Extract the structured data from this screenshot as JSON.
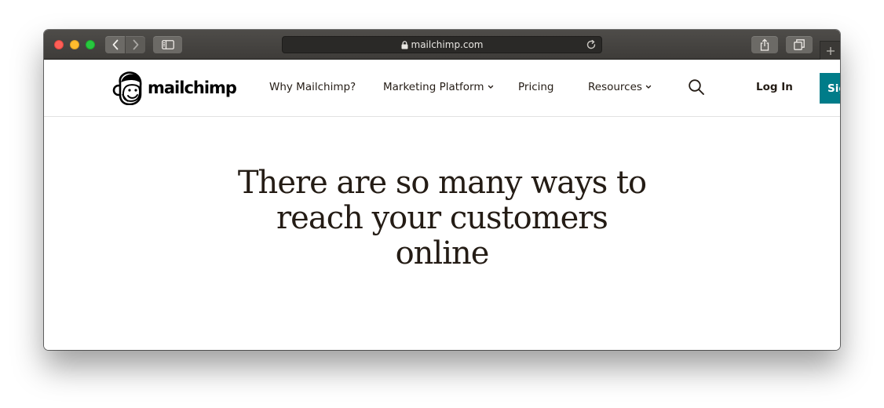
{
  "browser": {
    "url": "mailchimp.com",
    "icons": {
      "back": "chevron-left-icon",
      "forward": "chevron-right-icon",
      "sidebar": "sidebar-icon",
      "lock": "lock-icon",
      "reload": "reload-icon",
      "share": "share-icon",
      "tabs": "tabs-icon",
      "new_tab": "plus-icon"
    }
  },
  "site": {
    "logo_text": "mailchimp",
    "nav": {
      "why": "Why Mailchimp?",
      "platform": "Marketing Platform",
      "pricing": "Pricing",
      "resources": "Resources"
    },
    "login": "Log In",
    "signup": "Sig",
    "accent_color": "#007c89",
    "text_color": "#241c15"
  },
  "hero": {
    "headline": "There are so many ways to reach your customers online"
  }
}
